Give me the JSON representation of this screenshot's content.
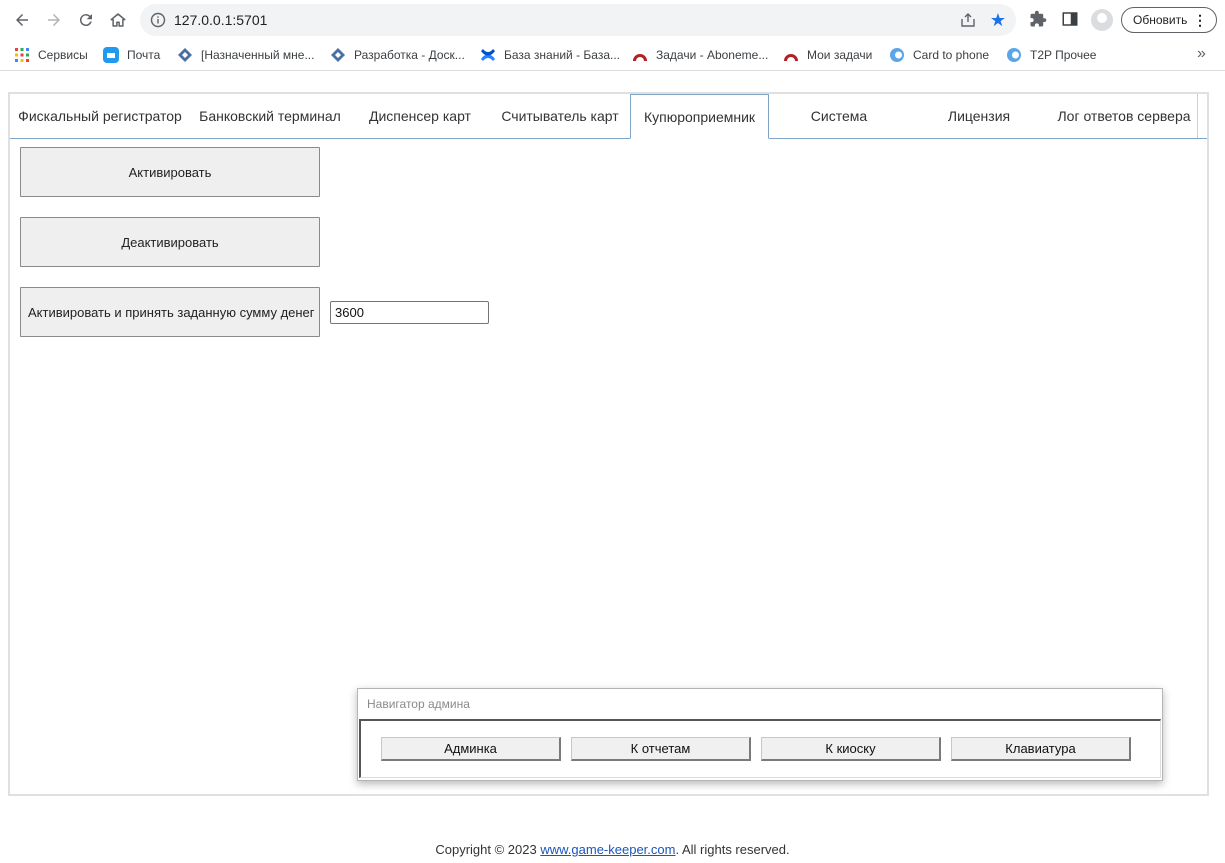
{
  "browser": {
    "url": "127.0.0.1:5701",
    "update_label": "Обновить",
    "menu_glyph": "⋮",
    "more_bookmarks": "»",
    "bookmarks": [
      {
        "label": "Сервисы",
        "icon": "apps-grid-icon"
      },
      {
        "label": "Почта",
        "icon": "mail-icon"
      },
      {
        "label": "[Назначенный мне...",
        "icon": "diamond-icon"
      },
      {
        "label": "Разработка - Доск...",
        "icon": "diamond-icon"
      },
      {
        "label": "База знаний - База...",
        "icon": "confluence-icon"
      },
      {
        "label": "Задачи - Aboneme...",
        "icon": "redmine-icon"
      },
      {
        "label": "Мои задачи",
        "icon": "redmine-icon"
      },
      {
        "label": "Card to phone",
        "icon": "blue-circle-icon"
      },
      {
        "label": "T2P Прочее",
        "icon": "blue-circle-icon"
      }
    ]
  },
  "tabs": [
    {
      "label": "Фискальный регистратор",
      "active": false
    },
    {
      "label": "Банковский терминал",
      "active": false
    },
    {
      "label": "Диспенсер карт",
      "active": false
    },
    {
      "label": "Считыватель карт",
      "active": false
    },
    {
      "label": "Купюроприемник",
      "active": true
    },
    {
      "label": "Система",
      "active": false
    },
    {
      "label": "Лицензия",
      "active": false
    },
    {
      "label": "Лог ответов сервера",
      "active": false
    }
  ],
  "bill_acceptor": {
    "activate_label": "Активировать",
    "deactivate_label": "Деактивировать",
    "activate_amount_label": "Активировать и принять заданную сумму денег",
    "amount_value": "3600"
  },
  "navigator": {
    "title": "Навигатор админа",
    "buttons": [
      "Админка",
      "К отчетам",
      "К киоску",
      "Клавиатура"
    ]
  },
  "footer": {
    "prefix": "Copyright © 2023 ",
    "link": "www.game-keeper.com",
    "suffix": ". All rights reserved."
  },
  "colors": {
    "accent": "#1a73e8",
    "tab_border": "#7fa6c9",
    "button_bg": "#efefef"
  }
}
